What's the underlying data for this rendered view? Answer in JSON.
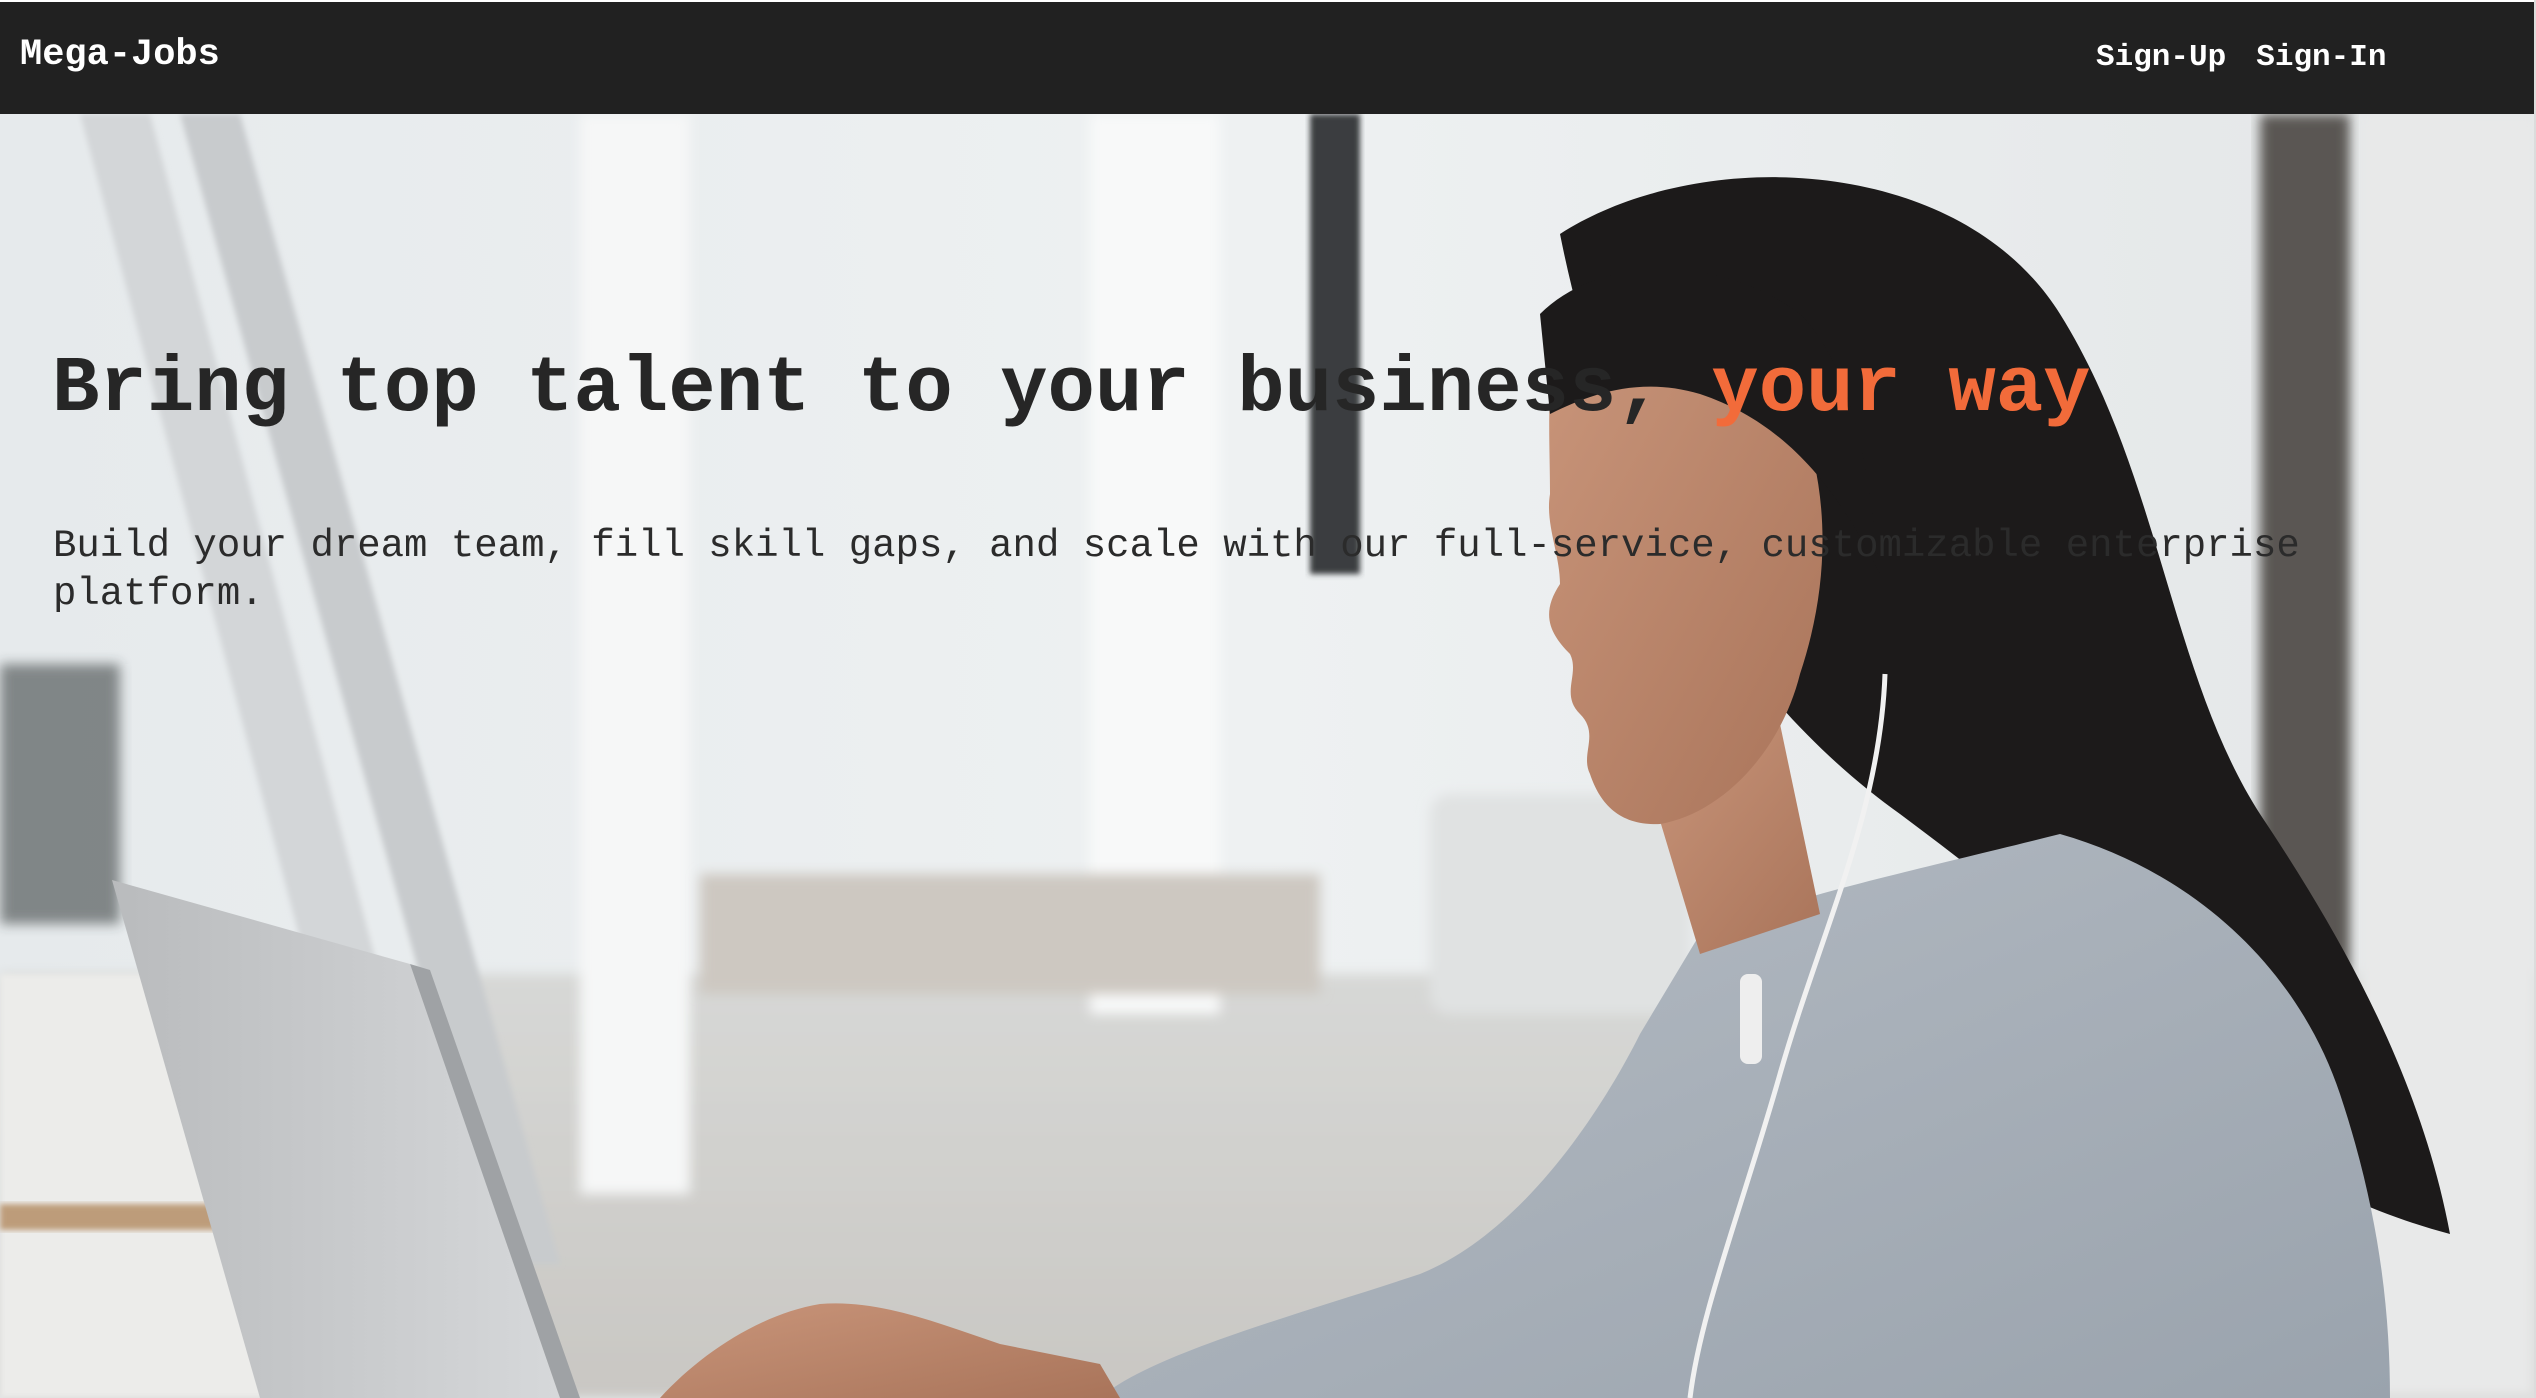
{
  "navbar": {
    "brand": "Mega-Jobs",
    "links": [
      {
        "label": "Sign-Up"
      },
      {
        "label": "Sign-In"
      }
    ]
  },
  "hero": {
    "title_main": "Bring top talent to your business, ",
    "title_accent": "your way",
    "subtitle": "Build your dream team, fill skill gaps, and scale with our full-service, customizable enterprise platform.",
    "image": "woman-working-on-laptop-photo"
  },
  "colors": {
    "navbar_bg": "#212121",
    "accent": "#f26b3a",
    "text_dark": "#262626",
    "nav_text": "#ffffff"
  }
}
